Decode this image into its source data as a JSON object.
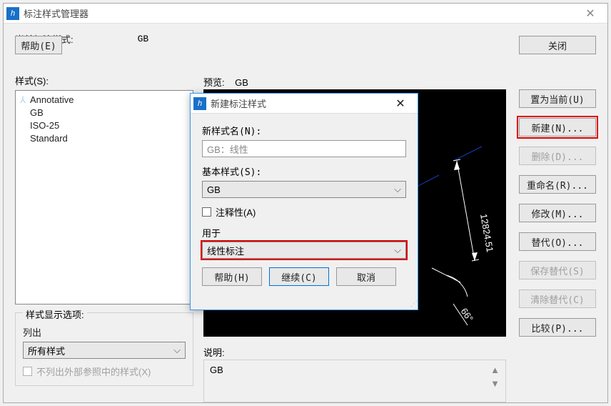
{
  "main": {
    "title": "标注样式管理器",
    "current_label": "当前标注样式:",
    "current_value": "GB",
    "styles_label": "样式(S):",
    "styles_list": [
      "Annotative",
      "GB",
      "ISO-25",
      "Standard"
    ],
    "preview_label": "预览:",
    "preview_value": "GB",
    "preview_dim_v": "12824.51",
    "preview_angle": "66°",
    "explain_label": "说明:",
    "explain_value": "GB",
    "display_group": "样式显示选项:",
    "list_label": "列出",
    "list_value": "所有样式",
    "hide_xref": "不列出外部参照中的样式(X)",
    "help": "帮助(E)",
    "close": "关闭"
  },
  "buttons": {
    "set_current": "置为当前(U)",
    "new": "新建(N)...",
    "delete": "删除(D)...",
    "rename": "重命名(R)...",
    "modify": "修改(M)...",
    "override": "替代(O)...",
    "save_override": "保存替代(S)",
    "clear_override": "清除替代(C)",
    "compare": "比较(P)..."
  },
  "dialog": {
    "title": "新建标注样式",
    "new_name_label": "新样式名(N):",
    "new_name_value": "GB：线性",
    "base_label": "基本样式(S):",
    "base_value": "GB",
    "annotative": "注释性(A)",
    "used_for_label": "用于",
    "used_for_value": "线性标注",
    "help": "帮助(H)",
    "continue": "继续(C)",
    "cancel": "取消"
  }
}
